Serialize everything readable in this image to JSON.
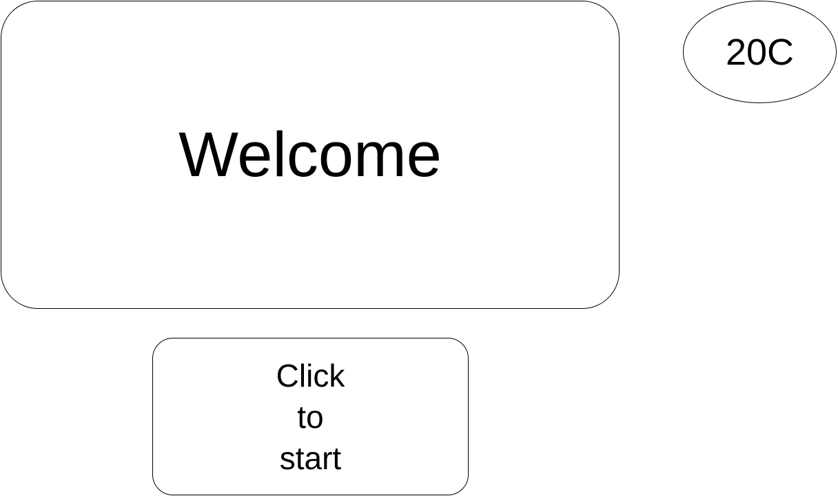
{
  "welcome": {
    "text": "Welcome"
  },
  "temperature": {
    "text": "20C"
  },
  "start_button": {
    "lines": [
      "Click",
      "to",
      "start"
    ]
  }
}
